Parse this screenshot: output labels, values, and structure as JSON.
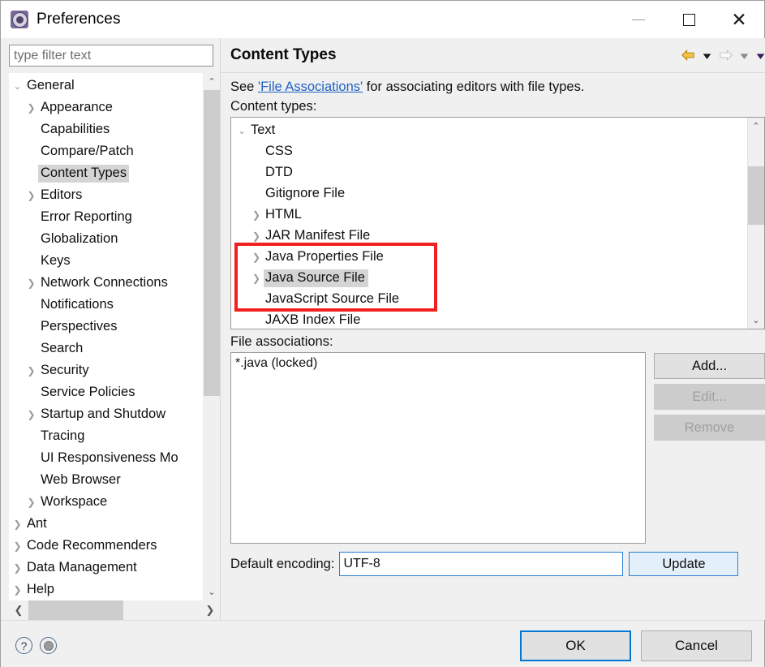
{
  "window": {
    "title": "Preferences",
    "icon": "gear-icon",
    "controls": {
      "minimize": "—",
      "maximize": "□",
      "close": "✕"
    }
  },
  "sidebar": {
    "filter": {
      "placeholder": "type filter text",
      "value": ""
    },
    "items": [
      {
        "label": "General",
        "level": 0,
        "twisty": "expanded",
        "selected": false
      },
      {
        "label": "Appearance",
        "level": 1,
        "twisty": "collapsed",
        "selected": false
      },
      {
        "label": "Capabilities",
        "level": 1,
        "twisty": "none",
        "selected": false
      },
      {
        "label": "Compare/Patch",
        "level": 1,
        "twisty": "none",
        "selected": false
      },
      {
        "label": "Content Types",
        "level": 1,
        "twisty": "none",
        "selected": true
      },
      {
        "label": "Editors",
        "level": 1,
        "twisty": "collapsed",
        "selected": false
      },
      {
        "label": "Error Reporting",
        "level": 1,
        "twisty": "none",
        "selected": false
      },
      {
        "label": "Globalization",
        "level": 1,
        "twisty": "none",
        "selected": false
      },
      {
        "label": "Keys",
        "level": 1,
        "twisty": "none",
        "selected": false
      },
      {
        "label": "Network Connections",
        "level": 1,
        "twisty": "collapsed",
        "selected": false
      },
      {
        "label": "Notifications",
        "level": 1,
        "twisty": "none",
        "selected": false
      },
      {
        "label": "Perspectives",
        "level": 1,
        "twisty": "none",
        "selected": false
      },
      {
        "label": "Search",
        "level": 1,
        "twisty": "none",
        "selected": false
      },
      {
        "label": "Security",
        "level": 1,
        "twisty": "collapsed",
        "selected": false
      },
      {
        "label": "Service Policies",
        "level": 1,
        "twisty": "none",
        "selected": false
      },
      {
        "label": "Startup and Shutdow",
        "level": 1,
        "twisty": "collapsed",
        "selected": false
      },
      {
        "label": "Tracing",
        "level": 1,
        "twisty": "none",
        "selected": false
      },
      {
        "label": "UI Responsiveness Mo",
        "level": 1,
        "twisty": "none",
        "selected": false
      },
      {
        "label": "Web Browser",
        "level": 1,
        "twisty": "none",
        "selected": false
      },
      {
        "label": "Workspace",
        "level": 1,
        "twisty": "collapsed",
        "selected": false
      },
      {
        "label": "Ant",
        "level": 0,
        "twisty": "collapsed",
        "selected": false
      },
      {
        "label": "Code Recommenders",
        "level": 0,
        "twisty": "collapsed",
        "selected": false
      },
      {
        "label": "Data Management",
        "level": 0,
        "twisty": "collapsed",
        "selected": false
      },
      {
        "label": "Help",
        "level": 0,
        "twisty": "collapsed",
        "selected": false
      }
    ]
  },
  "page": {
    "title": "Content Types",
    "nav": {
      "back_icon": "back-arrow-icon",
      "back_menu_icon": "chevron-down-icon",
      "forward_icon": "forward-arrow-icon",
      "forward_menu_icon": "chevron-down-icon",
      "view_menu_icon": "chevron-down-icon"
    },
    "description_prefix": "See ",
    "description_link": "'File Associations'",
    "description_suffix": " for associating editors with file types.",
    "content_types_label": "Content types:",
    "content_types": [
      {
        "label": "Text",
        "level": 0,
        "twisty": "expanded",
        "selected": false
      },
      {
        "label": "CSS",
        "level": 1,
        "twisty": "none",
        "selected": false
      },
      {
        "label": "DTD",
        "level": 1,
        "twisty": "none",
        "selected": false
      },
      {
        "label": "Gitignore File",
        "level": 1,
        "twisty": "none",
        "selected": false
      },
      {
        "label": "HTML",
        "level": 1,
        "twisty": "collapsed",
        "selected": false
      },
      {
        "label": "JAR Manifest File",
        "level": 1,
        "twisty": "collapsed",
        "selected": false
      },
      {
        "label": "Java Properties File",
        "level": 1,
        "twisty": "collapsed",
        "selected": false
      },
      {
        "label": "Java Source File",
        "level": 1,
        "twisty": "collapsed",
        "selected": true
      },
      {
        "label": "JavaScript Source File",
        "level": 1,
        "twisty": "none",
        "selected": false
      },
      {
        "label": "JAXB Index File",
        "level": 1,
        "twisty": "none",
        "selected": false
      }
    ],
    "file_associations_label": "File associations:",
    "file_associations": [
      "*.java (locked)"
    ],
    "buttons": {
      "add": "Add...",
      "edit": "Edit...",
      "remove": "Remove"
    },
    "encoding_label": "Default encoding:",
    "encoding_value": "UTF-8",
    "update_button": "Update"
  },
  "annotation": {
    "color": "#f02020",
    "type": "highlight-rectangle"
  },
  "footer": {
    "help_icon": "?",
    "secondary_icon": "restore-defaults-icon",
    "ok": "OK",
    "cancel": "Cancel"
  }
}
